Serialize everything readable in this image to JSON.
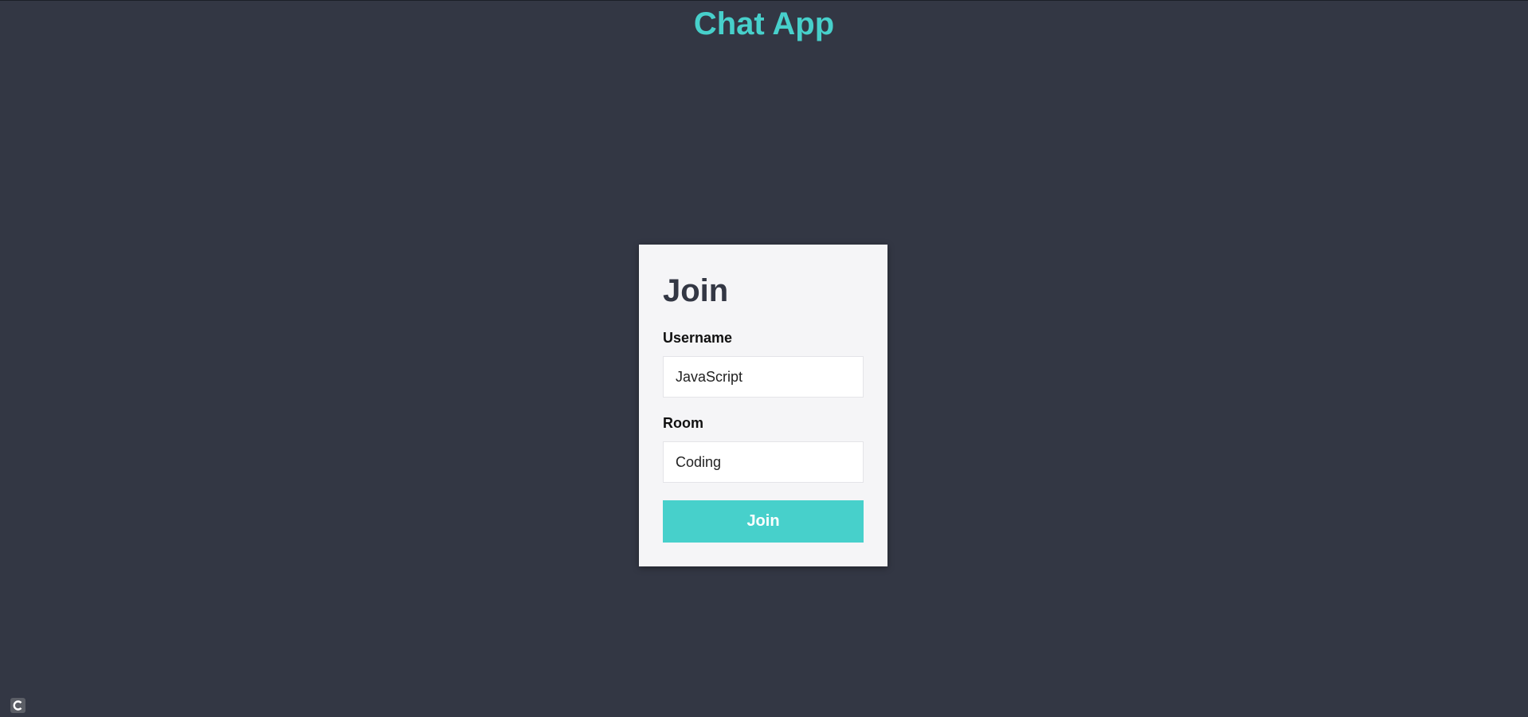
{
  "app": {
    "title": "Chat App",
    "accent_color": "#47d0cb",
    "background_color": "#333744"
  },
  "join_form": {
    "title": "Join",
    "username": {
      "label": "Username",
      "value": "JavaScript",
      "placeholder": ""
    },
    "room": {
      "label": "Room",
      "value": "Coding",
      "placeholder": ""
    },
    "submit_label": "Join"
  },
  "corner_widget": {
    "icon": "loading-c-icon"
  }
}
